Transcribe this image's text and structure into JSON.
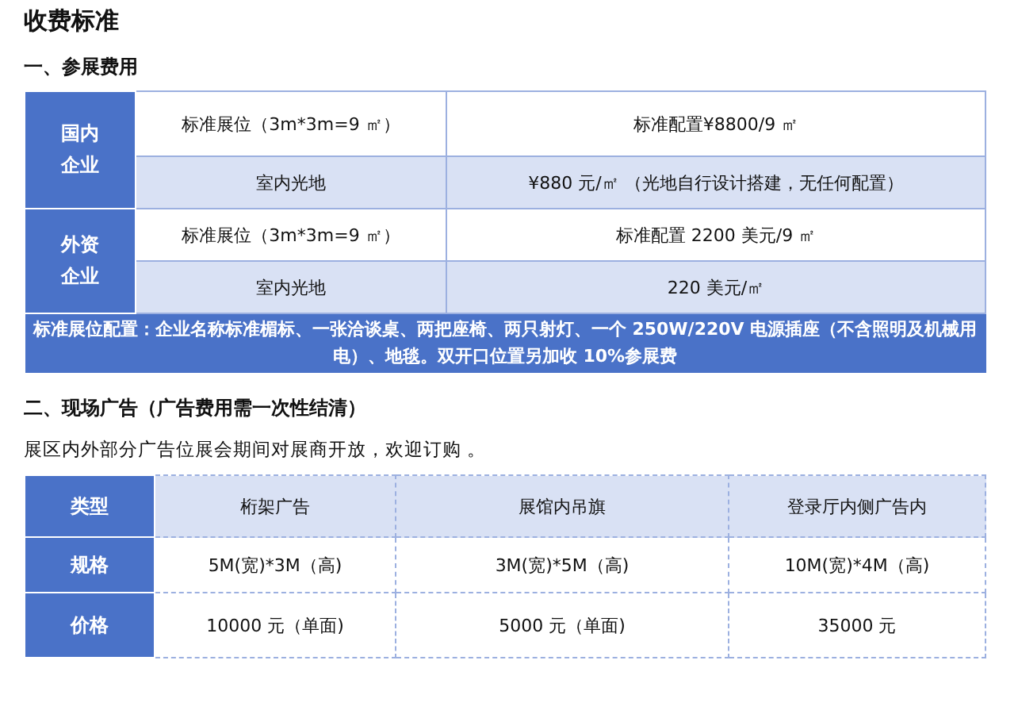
{
  "title": "收费标准",
  "section_1": {
    "heading": "一、参展费用",
    "groups": [
      {
        "label": "国内企业",
        "rows": [
          {
            "item": "标准展位（3m*3m=9 ㎡）",
            "price": "标准配置¥8800/9 ㎡"
          },
          {
            "item": "室内光地",
            "price": "¥880 元/㎡ （光地自行设计搭建，无任何配置）"
          }
        ]
      },
      {
        "label": "外资企业",
        "rows": [
          {
            "item": "标准展位（3m*3m=9 ㎡）",
            "price": "标准配置 2200 美元/9 ㎡"
          },
          {
            "item": "室内光地",
            "price": "220 美元/㎡"
          }
        ]
      }
    ],
    "note": "标准展位配置：企业名称标准楣标、一张洽谈桌、两把座椅、两只射灯、一个 250W/220V 电源插座（不含照明及机械用电）、地毯。双开口位置另加收 10%参展费"
  },
  "section_2": {
    "heading": "二、现场广告（广告费用需一次性结清）",
    "intro": "展区内外部分广告位展会期间对展商开放，欢迎订购 。",
    "header": {
      "label": "类型",
      "cells": [
        "桁架广告",
        "展馆内吊旗",
        "登录厅内侧广告内"
      ]
    },
    "rows": [
      {
        "label": "规格",
        "cells": [
          "5M(宽)*3M（高)",
          "3M(宽)*5M（高)",
          "10M(宽)*4M（高)"
        ]
      },
      {
        "label": "价格",
        "cells": [
          "10000 元（单面)",
          "5000 元（单面)",
          "35000 元"
        ]
      }
    ]
  }
}
